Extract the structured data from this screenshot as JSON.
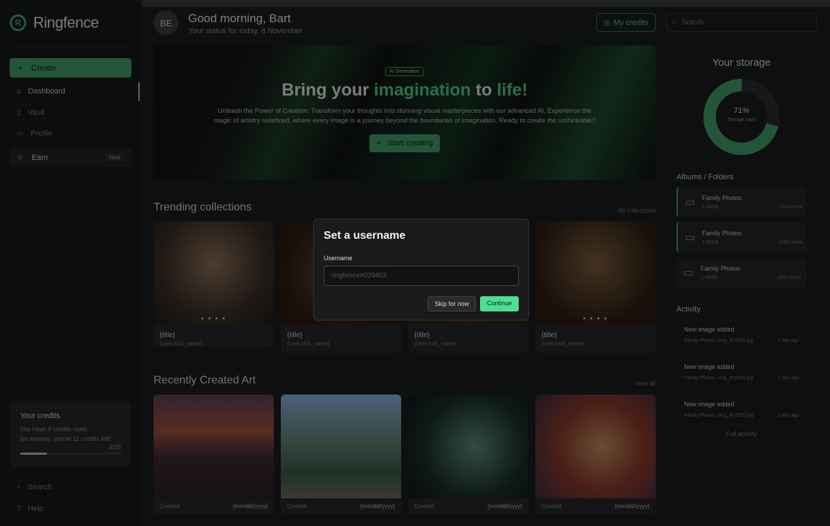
{
  "sidebar": {
    "brand": "Ringfence",
    "create_label": "Create",
    "items": [
      {
        "label": "Dashboard",
        "icon": "home-icon"
      },
      {
        "label": "Vault",
        "icon": "file-icon"
      },
      {
        "label": "Profile",
        "icon": "folder-icon"
      }
    ],
    "earn": {
      "label": "Earn",
      "badge": "New"
    },
    "credits": {
      "title": "Your credits",
      "line1": "You have 4 credits used.",
      "line2": "No worries, you've 11 credits left!",
      "count": "4/15",
      "used_fraction": 0.27
    },
    "bottom": [
      {
        "label": "Search",
        "icon": "search-icon"
      },
      {
        "label": "Help",
        "icon": "help-icon"
      }
    ]
  },
  "header": {
    "avatar": "BE",
    "greeting": "Good morning, Bart",
    "status": "Your status for today, 6 November",
    "credits_button": "My credits",
    "search_placeholder": "Search"
  },
  "hero": {
    "tag": "AI Generation",
    "title_a": "Bring your ",
    "title_b": "imagination",
    "title_c": " to ",
    "title_d": "life!",
    "body": "Unleash the Power of Creation: Transform your thoughts into stunning visual masterpieces with our advanced AI. Experience the magic of artistry redefined, where every image is a journey beyond the boundaries of imagination. Ready to create the unthinkable?",
    "button": "Start creating"
  },
  "trending": {
    "title": "Trending collections",
    "link": "All collections",
    "cards": [
      {
        "title": "{title}",
        "user": "{user.nick_name}"
      },
      {
        "title": "{title}",
        "user": "{user.nick_name}"
      },
      {
        "title": "{title}",
        "user": "{user.nick_name}"
      },
      {
        "title": "{title}",
        "user": "{user.nick_name}"
      }
    ]
  },
  "recent": {
    "title": "Recently Created Art",
    "link": "View all",
    "cards": [
      {
        "label": "Created",
        "date": "{mm/dd//yyyy}"
      },
      {
        "label": "Created",
        "date": "{mm/dd//yyyy}"
      },
      {
        "label": "Created",
        "date": "{mm/dd//yyyy}"
      },
      {
        "label": "Created",
        "date": "{mm/dd//yyyy}"
      }
    ]
  },
  "storage": {
    "title": "Your storage",
    "percent": "71%",
    "sub": "Storage used",
    "value": 71,
    "colors": {
      "used": "#3f9d66",
      "free": "#2a2b2e"
    }
  },
  "albums": {
    "title": "Albums / Folders",
    "items": [
      {
        "name": "Family Photos",
        "size": "1.45GB",
        "count": "1253 items"
      },
      {
        "name": "Family Photos",
        "size": "1.45GB",
        "count": "1253 items"
      },
      {
        "name": "Family Photos",
        "size": "1.45GB",
        "count": "1253 items"
      }
    ]
  },
  "activity": {
    "title": "Activity",
    "items": [
      {
        "title": "New image added",
        "path": "Family Photos / img_472922.jpg",
        "time": "2 min ago"
      },
      {
        "title": "New image added",
        "path": "Family Photos / img_472922.jpg",
        "time": "2 min ago"
      },
      {
        "title": "New image added",
        "path": "Family Photos / img_472922.jpg",
        "time": "2 min ago"
      }
    ],
    "link": "Full activity"
  },
  "modal": {
    "title": "Set a username",
    "label": "Username",
    "placeholder": "ringfence#029402",
    "skip": "Skip for now",
    "continue": "Continue"
  },
  "accent": "#4ede92"
}
